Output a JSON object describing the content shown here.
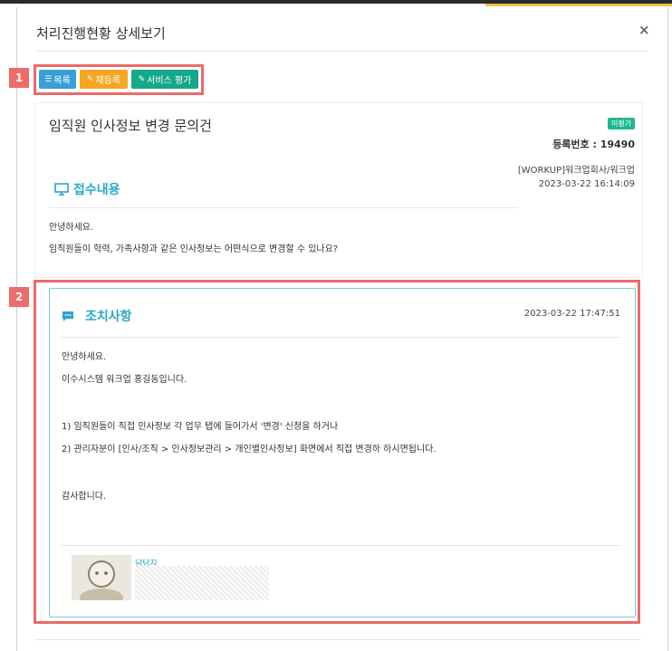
{
  "modal": {
    "title": "처리진행현황 상세보기",
    "close": "×"
  },
  "callouts": [
    "1",
    "2"
  ],
  "toolbar": {
    "list_label": "목록",
    "reregister_label": "재등록",
    "evaluate_label": "서비스 평가",
    "colors": {
      "list": "#3a9fd6",
      "reregister": "#f5a623",
      "evaluate": "#16a88a"
    }
  },
  "request": {
    "title": "임직원 인사정보 변경 문의건",
    "status_badge": "미평가",
    "reg_no": "등록번호 : 19490",
    "company": "[WORKUP]워크업회사/워크업",
    "datetime": "2023-03-22 16:14:09",
    "section_title": "접수내용",
    "lines": [
      "안녕하세요.",
      "임직원들이 학력, 가족사항과 같은 인사정보는 어떤식으로 변경할 수 있나요?"
    ]
  },
  "action": {
    "section_title": "조치사항",
    "datetime": "2023-03-22 17:47:51",
    "lines": [
      "안녕하세요.",
      "이수시스템 워크업 홍길동입니다.",
      "1) 임직원들이 직접 인사정보 각 업무 탭에 들어가서 '변경' 신청을 하거나",
      "2) 관리자분이 [인사/조직 > 인사정보관리 > 개인별인사정보] 화면에서 직접 변경하 하시면됩니다.",
      "감사합니다."
    ],
    "assignee_label": "담당자"
  },
  "accent": "#2aa7c9"
}
